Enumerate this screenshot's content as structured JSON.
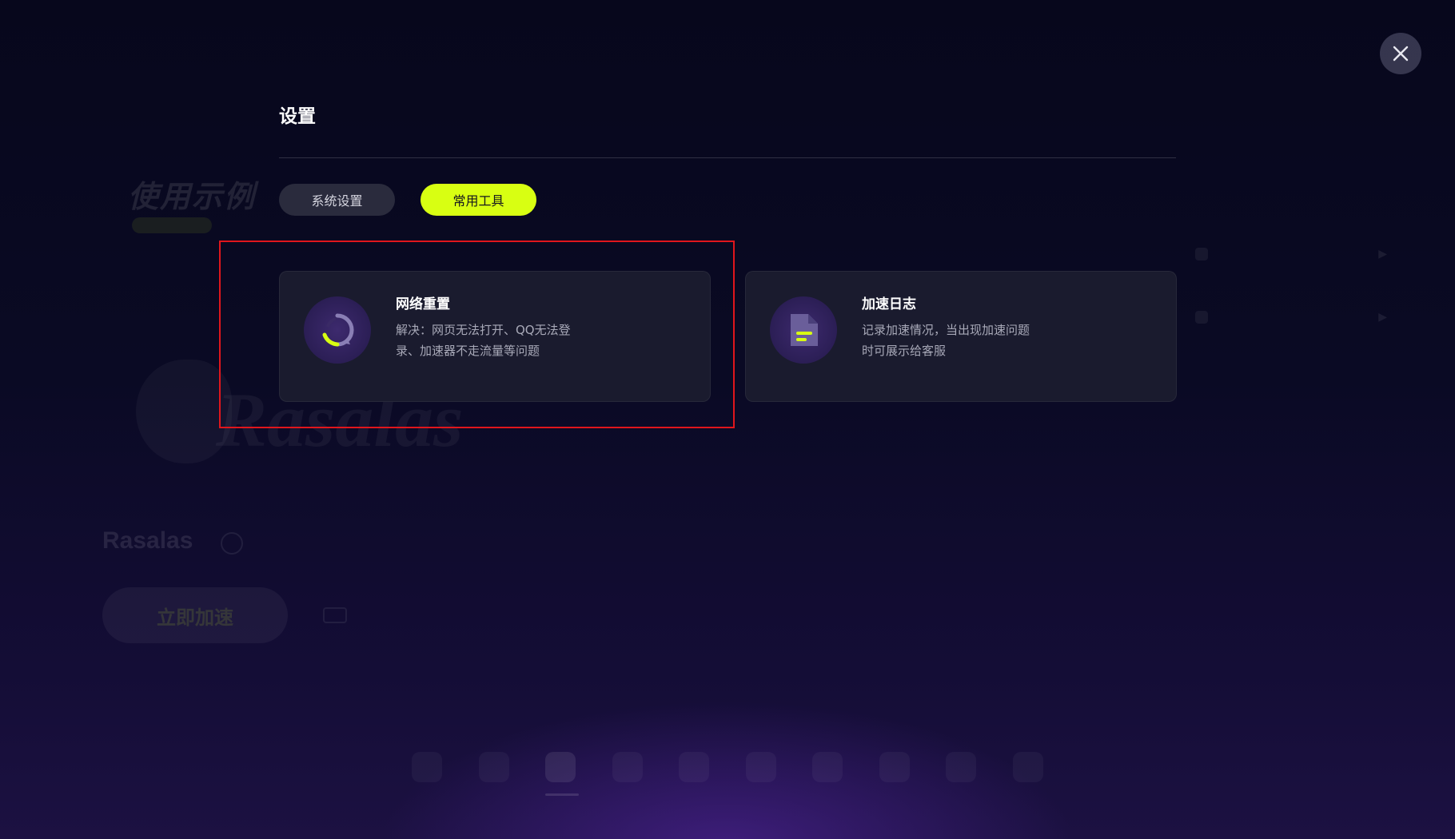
{
  "background": {
    "brand_name": "Rasalas",
    "accelerate_button": "立即加速"
  },
  "settings": {
    "title": "设置",
    "close_icon": "close-icon",
    "tabs": [
      {
        "label": "系统设置",
        "active": false
      },
      {
        "label": "常用工具",
        "active": true
      }
    ],
    "tools": [
      {
        "title": "网络重置",
        "description_line1": "解决：网页无法打开、QQ无法登",
        "description_line2": "录、加速器不走流量等问题",
        "icon": "refresh-icon"
      },
      {
        "title": "加速日志",
        "description_line1": "记录加速情况，当出现加速问题",
        "description_line2": "时可展示给客服",
        "icon": "document-icon"
      }
    ]
  },
  "colors": {
    "accent": "#d8ff12",
    "card_bg": "#1a1b2e",
    "highlight": "#e0161c"
  }
}
